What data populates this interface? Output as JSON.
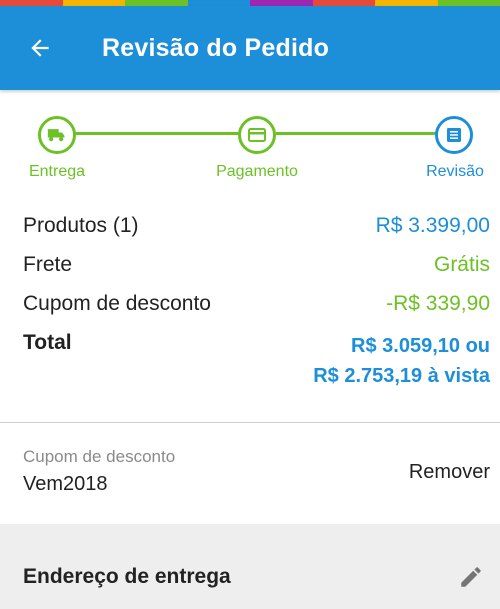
{
  "colors": {
    "primary": "#1d8ed8",
    "success": "#6cc125",
    "rainbow": [
      "#e64a3a",
      "#f4b400",
      "#6cc125",
      "#1d8ed8",
      "#9c27b0",
      "#e64a3a",
      "#f4b400",
      "#6cc125"
    ]
  },
  "appbar": {
    "title": "Revisão do Pedido",
    "back_icon": "arrow-left-icon"
  },
  "stepper": {
    "steps": [
      {
        "label": "Entrega",
        "icon": "truck-icon",
        "state": "done"
      },
      {
        "label": "Pagamento",
        "icon": "credit-card-icon",
        "state": "done"
      },
      {
        "label": "Revisão",
        "icon": "list-icon",
        "state": "active"
      }
    ]
  },
  "summary": {
    "products_label": "Produtos (1)",
    "products_value": "R$ 3.399,00",
    "shipping_label": "Frete",
    "shipping_value": "Grátis",
    "discount_label": "Cupom de desconto",
    "discount_value": "-R$ 339,90",
    "total_label": "Total",
    "total_line1": "R$ 3.059,10 ou",
    "total_line2": "R$ 2.753,19 à vista"
  },
  "coupon": {
    "label": "Cupom de desconto",
    "code": "Vem2018",
    "remove_label": "Remover"
  },
  "address": {
    "title": "Endereço de entrega",
    "edit_icon": "pencil-icon"
  }
}
